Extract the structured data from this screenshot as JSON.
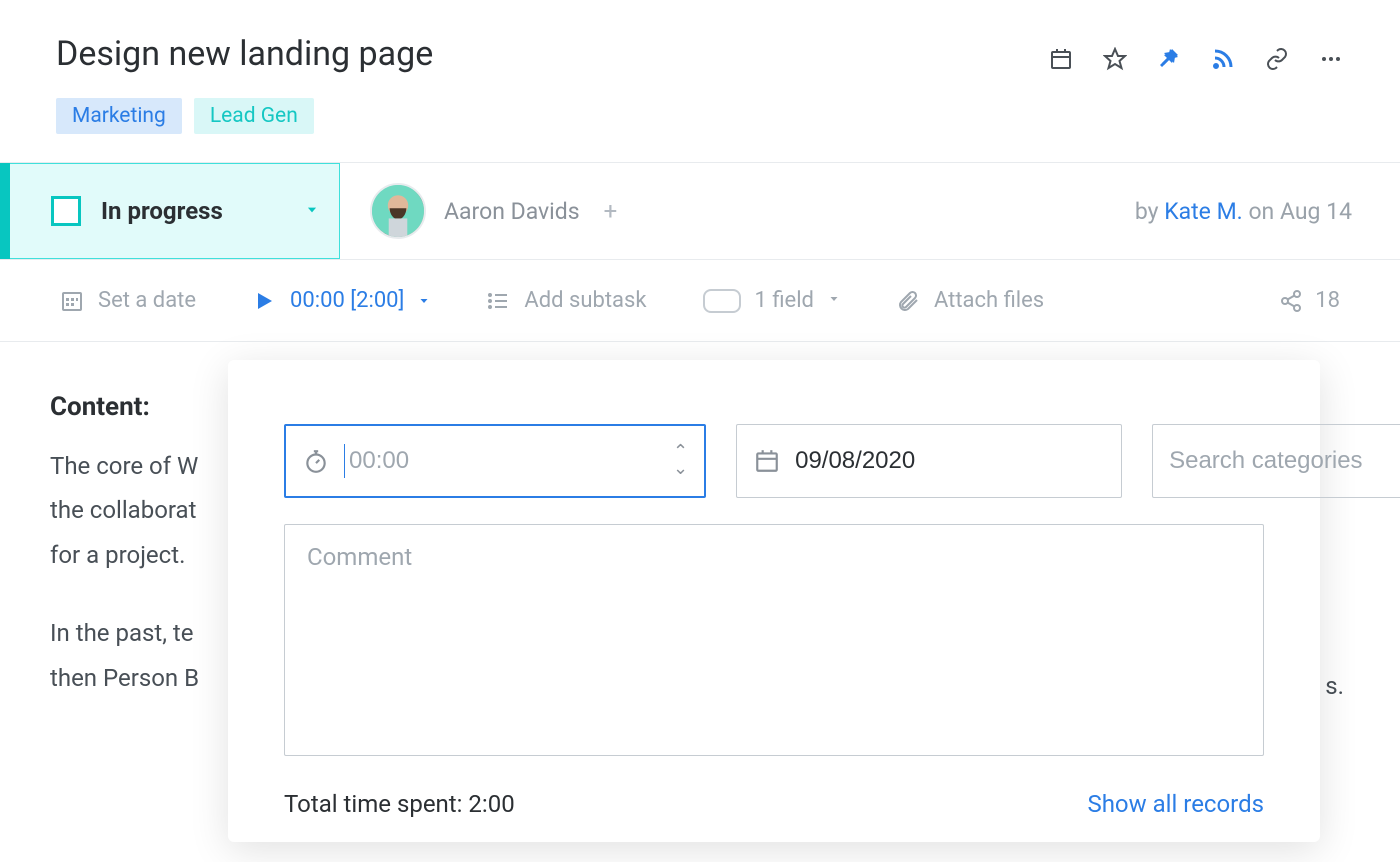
{
  "header": {
    "title": "Design new landing page",
    "tags": [
      {
        "label": "Marketing",
        "cls": "tag-blue"
      },
      {
        "label": "Lead Gen",
        "cls": "tag-teal"
      }
    ]
  },
  "status": {
    "label": "In progress"
  },
  "assignee": {
    "name": "Aaron Davids"
  },
  "meta": {
    "by_prefix": "by ",
    "author": "Kate M.",
    "date_suffix": " on Aug 14"
  },
  "toolbar": {
    "set_date": "Set a date",
    "timer": "00:00 [2:00]",
    "add_subtask": "Add subtask",
    "field_count": "1 field",
    "attach_files": "Attach files",
    "share_count": "18"
  },
  "content": {
    "heading": "Content:",
    "para1": "The core of W",
    "para1b": "the collaborat",
    "para1c": "for a project.",
    "para2": "In the past, te",
    "para2b": "then Person B",
    "visible_ending": "s."
  },
  "timePopover": {
    "time_placeholder": "00:00",
    "date_value": "09/08/2020",
    "categories_placeholder": "Search categories",
    "comment_placeholder": "Comment",
    "total_label": "Total time spent: ",
    "total_value": "2:00",
    "show_records": "Show all records"
  }
}
